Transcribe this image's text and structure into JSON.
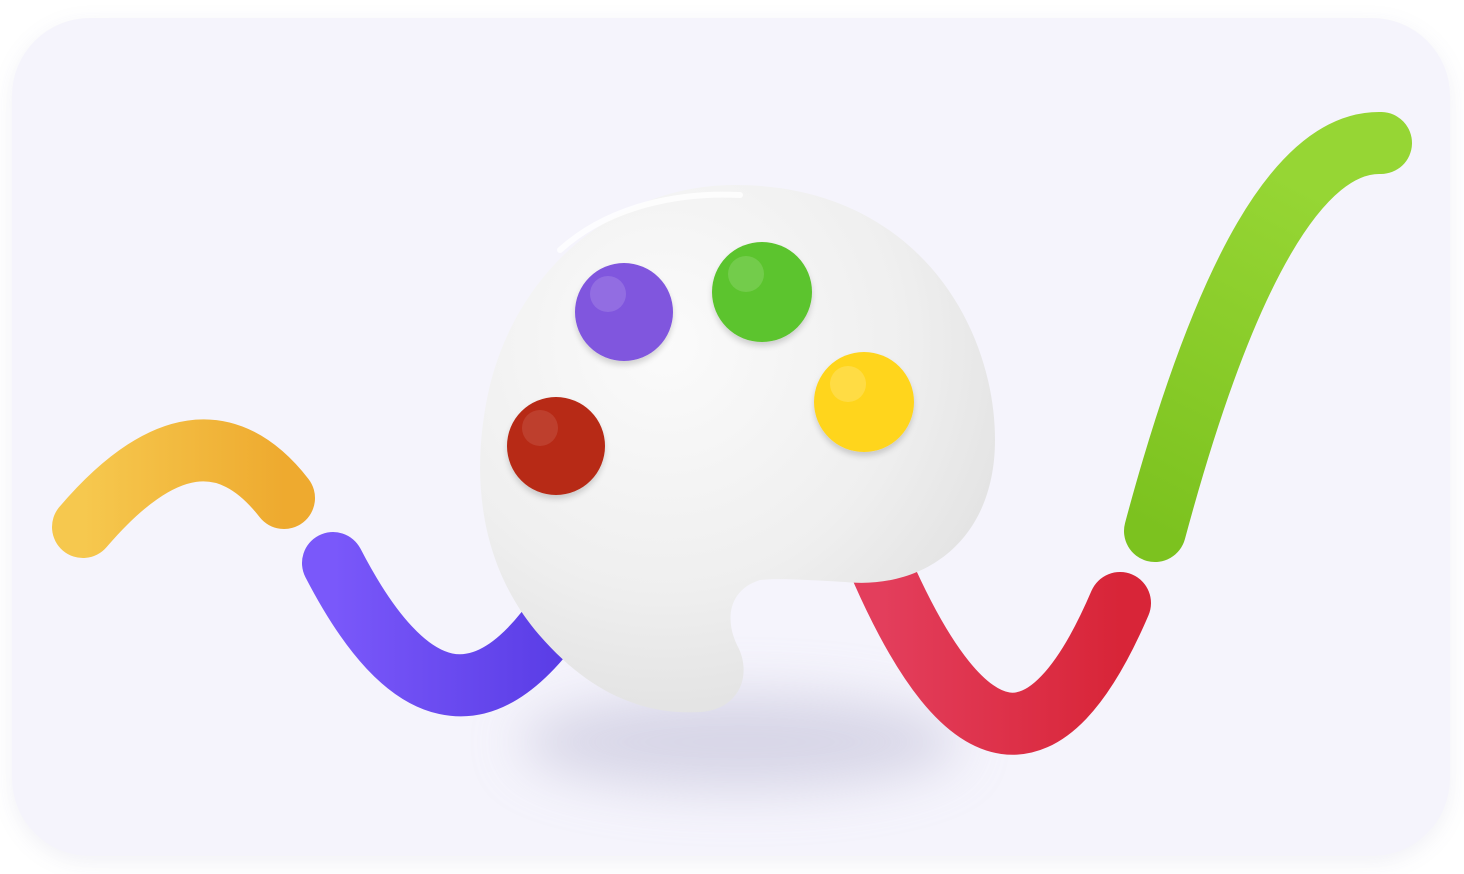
{
  "illustration": {
    "subject": "palette-icon",
    "background_color": "#f5f4fc",
    "palette_color": "#eeeeee",
    "strokes": [
      {
        "name": "yellow-stroke",
        "color": "#f4bf45"
      },
      {
        "name": "purple-stroke",
        "color": "#6a4cf2"
      },
      {
        "name": "red-stroke",
        "color": "#dd2c45"
      },
      {
        "name": "green-stroke",
        "color": "#86c826"
      }
    ],
    "paint_dots": [
      {
        "name": "red-paint-dot",
        "color": "#b72a16"
      },
      {
        "name": "purple-paint-dot",
        "color": "#8056de"
      },
      {
        "name": "green-paint-dot",
        "color": "#5cc42e"
      },
      {
        "name": "yellow-paint-dot",
        "color": "#ffd51e"
      }
    ]
  }
}
